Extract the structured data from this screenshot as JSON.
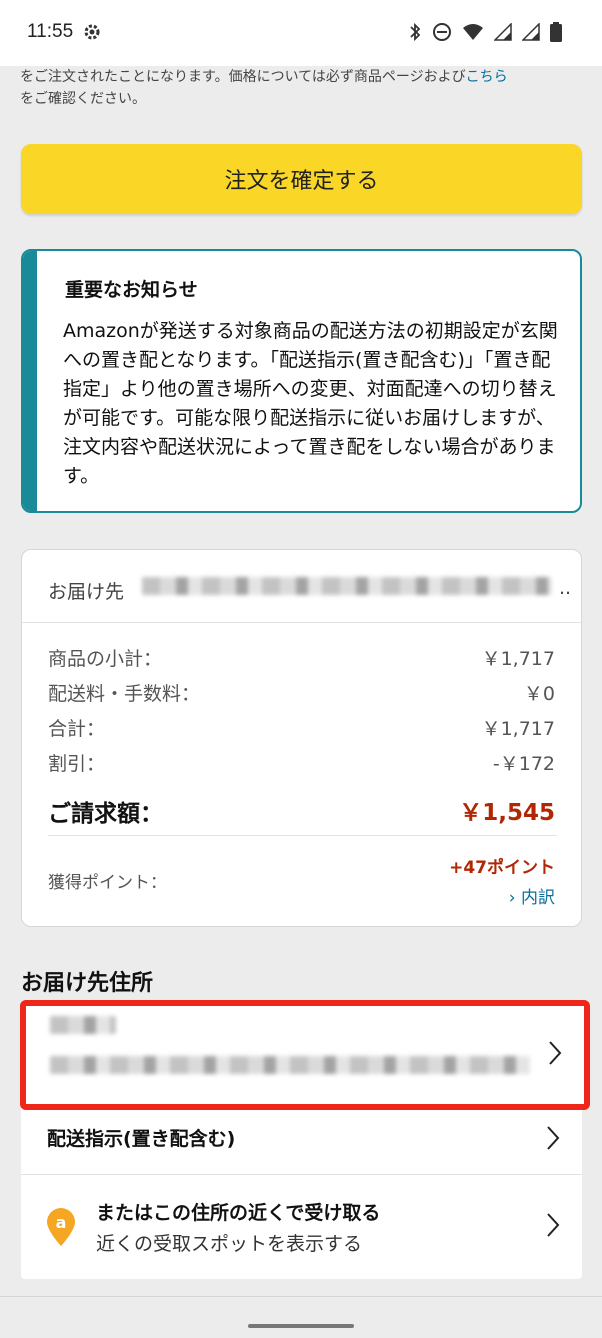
{
  "status_bar": {
    "time": "11:55",
    "icons": [
      "gear-icon",
      "bluetooth-icon",
      "do-not-disturb-icon",
      "wifi-icon",
      "signal-icon",
      "signal-icon-2",
      "battery-icon"
    ]
  },
  "top_note": {
    "text": "をご注文されたことになります。価格については必ず商品ページおよび",
    "link": "こちら",
    "text2": "をご確認ください。"
  },
  "confirm_button": {
    "label": "注文を確定する",
    "color": "#fad627"
  },
  "notice": {
    "title": "重要なお知らせ",
    "body": "Amazonが発送する対象商品の配送方法の初期設定が玄関への置き配となります。「配送指示(置き配含む)」「置き配指定」より他の置き場所への変更、対面配達への切り替えが可能です。可能な限り配送指示に従いお届けしますが、注文内容や配送状況によって置き配をしない場合があります。",
    "accent_color": "#1b8a98"
  },
  "summary": {
    "ship_to_label": "お届け先",
    "ellipsis": "..",
    "rows": [
      {
        "label": "商品の小計：",
        "value": "￥1,717"
      },
      {
        "label": "配送料・手数料：",
        "value": "￥0"
      },
      {
        "label": "合計：",
        "value": "￥1,717"
      },
      {
        "label": "割引：",
        "value": "-￥172"
      }
    ],
    "total_label": "ご請求額：",
    "total_value": "￥1,545",
    "points_label": "獲得ポイント：",
    "points_value": "+47ポイント",
    "points_detail": "› 内訳",
    "price_color": "#b12704"
  },
  "address_section": {
    "title": "お届け先住所",
    "highlight_color": "#f0261a",
    "delivery_instructions": "配送指示(置き配含む)",
    "pickup_title": "またはこの住所の近くで受け取る",
    "pickup_subtitle": "近くの受取スポットを表示する",
    "pickup_icon": "amazon-pin-icon"
  }
}
